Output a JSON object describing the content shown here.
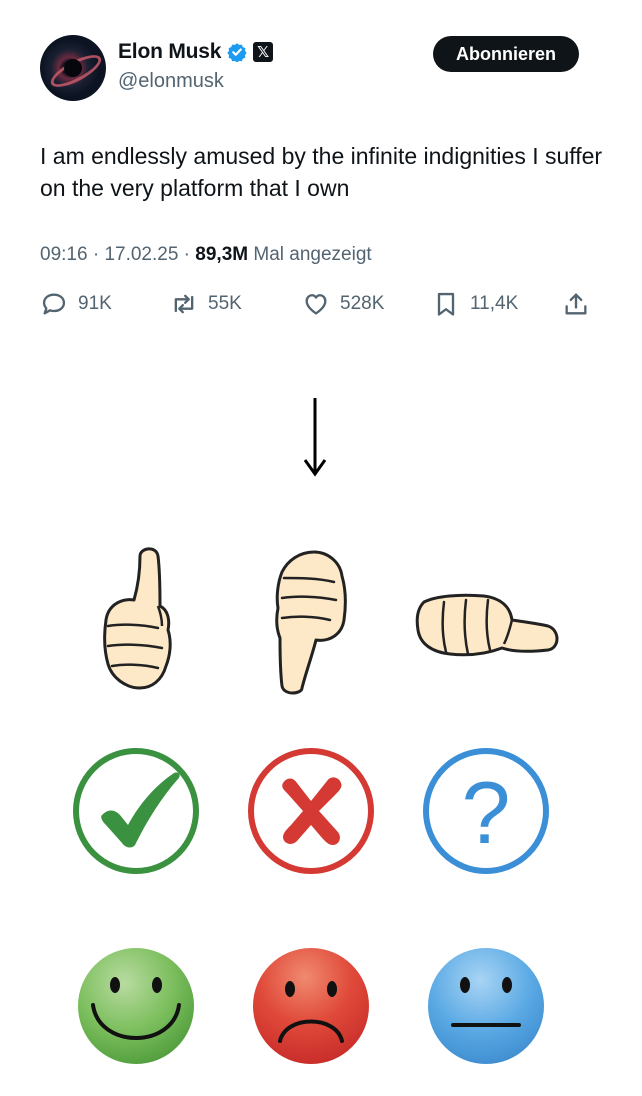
{
  "tweet": {
    "display_name": "Elon Musk",
    "handle": "@elonmusk",
    "subscribe_label": "Abonnieren",
    "x_badge": "𝕏",
    "text": "I am endlessly amused by the infinite indignities I suffer on the very platform that I own",
    "time": "09:16",
    "date": "17.02.25",
    "views": "89,3M",
    "views_label": "Mal angezeigt",
    "replies": "91K",
    "reposts": "55K",
    "likes": "528K",
    "bookmarks": "11,4K"
  },
  "icons": {
    "reply": "reply-icon",
    "repost": "repost-icon",
    "like": "heart-icon",
    "bookmark": "bookmark-icon",
    "share": "share-icon"
  },
  "colors": {
    "text": "#0f1419",
    "secondary": "#536471",
    "verified_blue": "#1d9bf0",
    "green": "#3a9140",
    "red": "#d43a33",
    "blue": "#3a8fd6",
    "skin": "#fde9c8"
  },
  "reaction_grid": {
    "hands": [
      "thumbs-up",
      "thumbs-down",
      "thumbs-sideways"
    ],
    "symbols": [
      "check",
      "cross",
      "question"
    ],
    "question_mark": "?",
    "faces": [
      "happy",
      "sad",
      "neutral"
    ]
  }
}
